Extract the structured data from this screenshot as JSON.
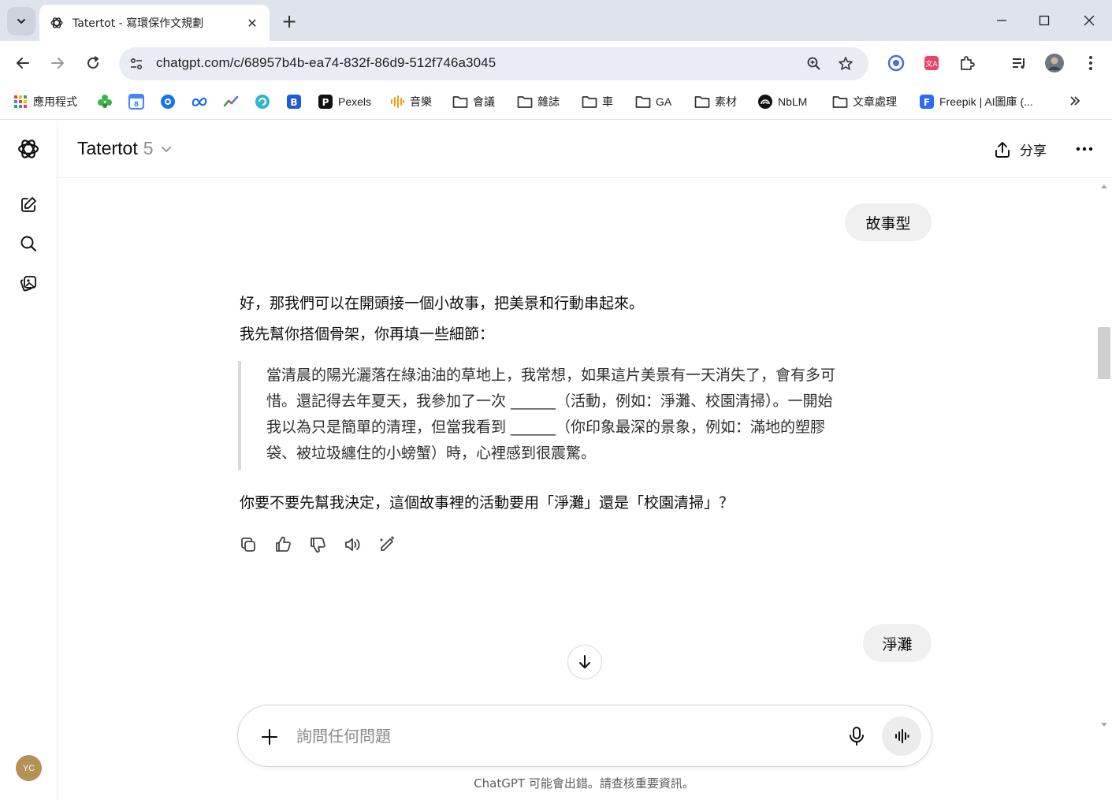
{
  "browser": {
    "tab_title": "Tatertot - 寫環保作文規劃",
    "url": "chatgpt.com/c/68957b4b-ea74-832f-86d9-512f746a3045",
    "bookmarks": [
      {
        "label": "應用程式",
        "icon": "apps-grid-icon"
      },
      {
        "label": "",
        "icon": "green-clover-icon"
      },
      {
        "label": "",
        "icon": "calendar-icon"
      },
      {
        "label": "",
        "icon": "circle-logo-icon"
      },
      {
        "label": "",
        "icon": "meta-icon"
      },
      {
        "label": "",
        "icon": "trend-chart-icon"
      },
      {
        "label": "",
        "icon": "swirl-icon"
      },
      {
        "label": "",
        "icon": "b-logo-icon"
      },
      {
        "label": "Pexels",
        "icon": "pexels-icon"
      },
      {
        "label": "音樂",
        "icon": "waveform-icon"
      },
      {
        "label": "會議",
        "icon": "folder-icon"
      },
      {
        "label": "雜誌",
        "icon": "folder-icon"
      },
      {
        "label": "車",
        "icon": "folder-icon"
      },
      {
        "label": "GA",
        "icon": "folder-icon"
      },
      {
        "label": "素材",
        "icon": "folder-icon"
      },
      {
        "label": "NbLM",
        "icon": "notebooklm-icon"
      },
      {
        "label": "文章處理",
        "icon": "folder-icon"
      },
      {
        "label": "Freepik | AI圖庫 (...",
        "icon": "freepik-icon"
      }
    ]
  },
  "header": {
    "model_name": "Tatertot",
    "model_version": "5",
    "share_label": "分享"
  },
  "conversation": {
    "user_message_1": "故事型",
    "assistant_line_1": "好，那我們可以在開頭接一個小故事，把美景和行動串起來。",
    "assistant_line_2": "我先幫你搭個骨架，你再填一些細節：",
    "quote_lines": [
      "當清晨的陽光灑落在綠油油的草地上，我常想，如果這片美景有一天消失了，會有多可",
      "惜。還記得去年夏天，我參加了一次 ______（活動，例如：淨灘、校園清掃）。一開始",
      "我以為只是簡單的清理，但當我看到 ______（你印象最深的景象，例如：滿地的塑膠",
      "袋、被垃圾纏住的小螃蟹）時，心裡感到很震驚。"
    ],
    "assistant_line_3": "你要不要先幫我決定，這個故事裡的活動要用「淨灘」還是「校園清掃」？",
    "user_message_2": "淨灘"
  },
  "composer": {
    "placeholder": "詢問任何問題",
    "value": ""
  },
  "sidebar": {
    "avatar_initials": "YC"
  },
  "footer": {
    "disclaimer": "ChatGPT 可能會出錯。請查核重要資訊。"
  },
  "colors": {
    "tabstrip_bg": "#dfe3eb",
    "omnibox_bg": "#e9edf3",
    "bubble_bg": "#f0f0f0",
    "avatar_bg": "#b39157"
  }
}
